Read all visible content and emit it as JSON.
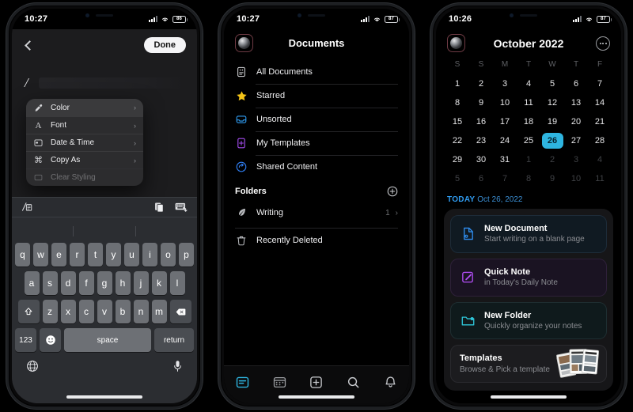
{
  "phone1": {
    "status": {
      "time": "10:27",
      "battery": "86",
      "signal_icon": "cellular-signal-icon",
      "wifi_icon": "wifi-icon"
    },
    "nav": {
      "back_icon": "chevron-left-icon",
      "done_label": "Done"
    },
    "editor": {
      "text": "/"
    },
    "context_menu": {
      "items": [
        {
          "label": "Color",
          "icon": "color-dropper-icon",
          "selected": true,
          "arrow": "›"
        },
        {
          "label": "Font",
          "icon": "font-a-icon",
          "selected": false,
          "arrow": "›"
        },
        {
          "label": "Date & Time",
          "icon": "calendar-icon",
          "selected": false,
          "arrow": "›"
        },
        {
          "label": "Copy As",
          "icon": "command-icon",
          "selected": false,
          "arrow": "›"
        },
        {
          "label": "Clear Styling",
          "icon": "clear-styling-icon",
          "selected": false,
          "arrow": ""
        }
      ]
    },
    "keyboard_toolbar": {
      "left_icon": "slash-command-icon",
      "right_icons": [
        "paste-clipboard-icon",
        "dismiss-keyboard-icon"
      ]
    },
    "keyboard": {
      "row1": [
        "q",
        "w",
        "e",
        "r",
        "t",
        "y",
        "u",
        "i",
        "o",
        "p"
      ],
      "row2": [
        "a",
        "s",
        "d",
        "f",
        "g",
        "h",
        "j",
        "k",
        "l"
      ],
      "row3": [
        "z",
        "x",
        "c",
        "v",
        "b",
        "n",
        "m"
      ],
      "shift_icon": "shift-icon",
      "backspace_icon": "backspace-icon",
      "numbers_label": "123",
      "emoji_icon": "emoji-icon",
      "space_label": "space",
      "return_label": "return",
      "globe_icon": "globe-icon",
      "mic_icon": "microphone-icon"
    }
  },
  "phone2": {
    "status": {
      "time": "10:27",
      "battery": "87"
    },
    "header": {
      "title": "Documents",
      "avatar_icon": "user-avatar-icon"
    },
    "library": [
      {
        "label": "All Documents",
        "icon": "all-documents-icon",
        "color": "#d7d8db"
      },
      {
        "label": "Starred",
        "icon": "star-icon",
        "color": "#f5c518"
      },
      {
        "label": "Unsorted",
        "icon": "inbox-icon",
        "color": "#2f9bf0"
      },
      {
        "label": "My Templates",
        "icon": "templates-icon",
        "color": "#a54df0"
      },
      {
        "label": "Shared Content",
        "icon": "shared-content-icon",
        "color": "#2f7df0"
      }
    ],
    "folders_section": {
      "title": "Folders",
      "add_icon": "plus-circle-icon"
    },
    "folders": [
      {
        "label": "Writing",
        "icon": "feather-pen-icon",
        "count": "1",
        "arrow": "›"
      }
    ],
    "recently_deleted": {
      "label": "Recently Deleted",
      "icon": "trash-icon"
    },
    "tabs": [
      {
        "name": "documents",
        "icon": "documents-tab-icon",
        "active": true
      },
      {
        "name": "calendar",
        "icon": "calendar-tab-icon",
        "active": false
      },
      {
        "name": "new",
        "icon": "plus-square-icon",
        "active": false
      },
      {
        "name": "search",
        "icon": "search-icon",
        "active": false
      },
      {
        "name": "notifications",
        "icon": "bell-icon",
        "active": false
      }
    ],
    "accent_color": "#2eb5e0"
  },
  "phone3": {
    "status": {
      "time": "10:26",
      "battery": "87"
    },
    "header": {
      "title": "October 2022",
      "avatar_icon": "user-avatar-icon",
      "more_icon": "more-circle-icon"
    },
    "calendar": {
      "weekdays": [
        "S",
        "S",
        "M",
        "T",
        "W",
        "T",
        "F"
      ],
      "weeks": [
        [
          {
            "d": "1"
          },
          {
            "d": "2"
          },
          {
            "d": "3"
          },
          {
            "d": "4"
          },
          {
            "d": "5"
          },
          {
            "d": "6"
          },
          {
            "d": "7"
          }
        ],
        [
          {
            "d": "8"
          },
          {
            "d": "9"
          },
          {
            "d": "10"
          },
          {
            "d": "11"
          },
          {
            "d": "12"
          },
          {
            "d": "13"
          },
          {
            "d": "14"
          }
        ],
        [
          {
            "d": "15"
          },
          {
            "d": "16"
          },
          {
            "d": "17"
          },
          {
            "d": "18"
          },
          {
            "d": "19"
          },
          {
            "d": "20"
          },
          {
            "d": "21"
          }
        ],
        [
          {
            "d": "22"
          },
          {
            "d": "23"
          },
          {
            "d": "24"
          },
          {
            "d": "25"
          },
          {
            "d": "26",
            "today": true
          },
          {
            "d": "27"
          },
          {
            "d": "28"
          }
        ],
        [
          {
            "d": "29"
          },
          {
            "d": "30"
          },
          {
            "d": "31"
          },
          {
            "d": "1",
            "dim": true
          },
          {
            "d": "2",
            "dim": true
          },
          {
            "d": "3",
            "dim": true
          },
          {
            "d": "4",
            "dim": true
          }
        ],
        [
          {
            "d": "5",
            "dim": true
          },
          {
            "d": "6",
            "dim": true
          },
          {
            "d": "7",
            "dim": true
          },
          {
            "d": "8",
            "dim": true
          },
          {
            "d": "9",
            "dim": true
          },
          {
            "d": "10",
            "dim": true
          },
          {
            "d": "11",
            "dim": true
          }
        ]
      ],
      "selected_day": "26",
      "selected_color": "#2eb5e0"
    },
    "today_label": {
      "prefix": "TODAY",
      "date": "Oct 26, 2022"
    },
    "cards": [
      {
        "title": "New Document",
        "subtitle": "Start writing on a blank page",
        "icon": "new-document-icon",
        "tone": "blue"
      },
      {
        "title": "Quick Note",
        "subtitle": "in Today's Daily Note",
        "icon": "quick-note-icon",
        "tone": "purple"
      },
      {
        "title": "New Folder",
        "subtitle": "Quickly organize your notes",
        "icon": "new-folder-icon",
        "tone": "teal"
      },
      {
        "title": "Templates",
        "subtitle": "Browse & Pick a template",
        "icon": "templates-thumbnail-icon",
        "tone": "plain"
      }
    ]
  }
}
